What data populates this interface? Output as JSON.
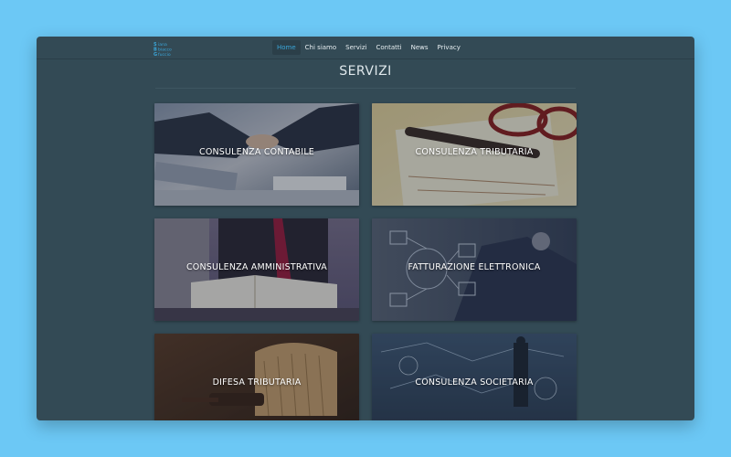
{
  "nav": {
    "logo_lines": [
      "iana",
      "biacco",
      "fuccio"
    ],
    "items": [
      {
        "label": "Home",
        "active": true
      },
      {
        "label": "Chi siamo",
        "active": false
      },
      {
        "label": "Servizi",
        "active": false
      },
      {
        "label": "Contatti",
        "active": false
      },
      {
        "label": "News",
        "active": false
      },
      {
        "label": "Privacy",
        "active": false
      }
    ]
  },
  "page": {
    "title": "SERVIZI"
  },
  "services": [
    {
      "label": "CONSULENZA CONTABILE"
    },
    {
      "label": "CONSULENZA TRIBUTARIA"
    },
    {
      "label": "CONSULENZA AMMINISTRATIVA"
    },
    {
      "label": "FATTURAZIONE ELETTRONICA"
    },
    {
      "label": "DIFESA TRIBUTARIA"
    },
    {
      "label": "CONSULENZA SOCIETARIA"
    }
  ],
  "colors": {
    "background": "#6cc8f5",
    "window": "#334a55",
    "accent": "#3aa5d8"
  }
}
